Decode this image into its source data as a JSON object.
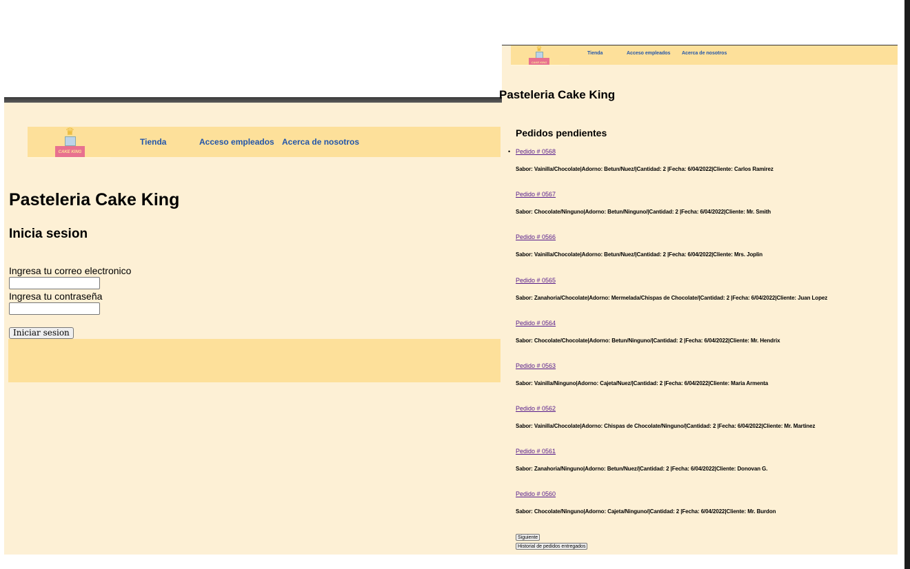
{
  "left_window": {
    "logo_text": "CAKE KING",
    "nav": {
      "tienda": "Tienda",
      "acceso": "Acceso empleados",
      "acerca": "Acerca de nosotros"
    },
    "title": "Pasteleria Cake King",
    "subtitle": "Inicia sesion",
    "email_label": "Ingresa tu correo electronico",
    "email_value": "",
    "password_label": "Ingresa tu contraseña",
    "password_value": "",
    "login_button": "Iniciar sesion"
  },
  "right_window": {
    "logo_text": "CAKE KING",
    "nav": {
      "tienda": "Tienda",
      "acceso": "Acceso empleados",
      "acerca": "Acerca de nosotros"
    },
    "title": "Pasteleria Cake King",
    "section_title": "Pedidos pendientes",
    "orders": [
      {
        "link": "Pedido # 0568",
        "detail": "Sabor: Vainilla/Chocolate|Adorno: Betun/Nuez/|Cantidad: 2 |Fecha: 6/04/2022|Cliente: Carlos Ramirez"
      },
      {
        "link": "Pedido # 0567",
        "detail": "Sabor: Chocolate/Ninguno|Adorno: Betun/Ninguno/|Cantidad: 2 |Fecha: 6/04/2022|Cliente: Mr. Smith"
      },
      {
        "link": "Pedido # 0566",
        "detail": "Sabor: Vainilla/Chocolate|Adorno: Betun/Nuez/|Cantidad: 2 |Fecha: 6/04/2022|Cliente: Mrs. Joplin"
      },
      {
        "link": "Pedido # 0565",
        "detail": "Sabor: Zanahoria/Chocolate|Adorno: Mermelada/Chispas de Chocolate/|Cantidad: 2 |Fecha: 6/04/2022|Cliente: Juan Lopez"
      },
      {
        "link": "Pedido # 0564",
        "detail": "Sabor: Chocolate/Chocolate|Adorno: Betun/Ninguno/|Cantidad: 2 |Fecha: 6/04/2022|Cliente: Mr. Hendrix"
      },
      {
        "link": "Pedido # 0563",
        "detail": "Sabor: Vainilla/Ninguno|Adorno: Cajeta/Nuez/|Cantidad: 2 |Fecha: 6/04/2022|Cliente: Maria Armenta"
      },
      {
        "link": "Pedido # 0562",
        "detail": "Sabor: Vainilla/Chocolate|Adorno: Chispas de Chocolate/Ninguno/|Cantidad: 2 |Fecha: 6/04/2022|Cliente: Mr. Martinez"
      },
      {
        "link": "Pedido # 0561",
        "detail": "Sabor: Zanahoria/Ninguno|Adorno: Betun/Nuez/|Cantidad: 2 |Fecha: 6/04/2022|Cliente: Donovan G."
      },
      {
        "link": "Pedido # 0560",
        "detail": "Sabor: Chocolate/Ninguno|Adorno: Cajeta/Ninguno/|Cantidad: 2 |Fecha: 6/04/2022|Cliente: Mr. Burdon"
      }
    ],
    "next_button": "Siguiente",
    "history_button": "Historial de pedidos entregados"
  }
}
